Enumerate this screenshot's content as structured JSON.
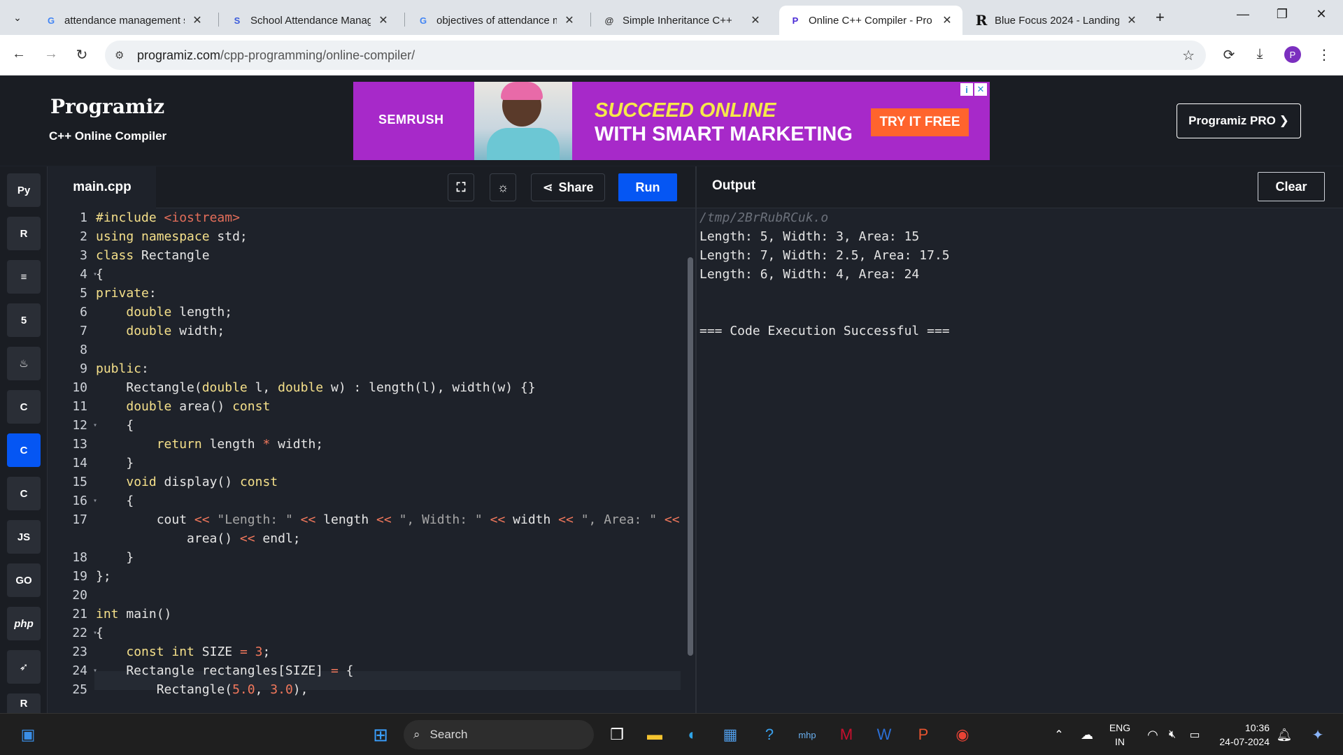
{
  "browser": {
    "tabs": [
      {
        "title": "attendance management s",
        "favicon": "G"
      },
      {
        "title": "School Attendance Manag",
        "favicon": "S"
      },
      {
        "title": "objectives of attendance m",
        "favicon": "G"
      },
      {
        "title": "Simple Inheritance C++",
        "favicon": "@"
      },
      {
        "title": "Online C++ Compiler - Pro",
        "favicon": "P"
      },
      {
        "title": "Blue Focus 2024 - Landing",
        "favicon": "R"
      }
    ],
    "url_domain": "programiz.com",
    "url_path": "/cpp-programming/online-compiler/",
    "profile_initial": "P"
  },
  "site": {
    "logo": "Programiz",
    "subtitle": "C++ Online Compiler",
    "pro_button": "Programiz PRO ❯"
  },
  "ad": {
    "brand": "SEMRUSH",
    "headline_1": "SUCCEED ONLINE",
    "headline_2": "WITH SMART MARKETING",
    "cta": "TRY IT FREE"
  },
  "languages": [
    {
      "name": "python",
      "glyph": "Py"
    },
    {
      "name": "r",
      "glyph": "R"
    },
    {
      "name": "sql",
      "glyph": "≡"
    },
    {
      "name": "html",
      "glyph": "5"
    },
    {
      "name": "java",
      "glyph": "♨"
    },
    {
      "name": "c",
      "glyph": "C"
    },
    {
      "name": "cpp",
      "glyph": "C"
    },
    {
      "name": "csharp",
      "glyph": "C"
    },
    {
      "name": "javascript",
      "glyph": "JS"
    },
    {
      "name": "go",
      "glyph": "GO"
    },
    {
      "name": "php",
      "glyph": "php"
    },
    {
      "name": "swift",
      "glyph": "➶"
    },
    {
      "name": "rust",
      "glyph": "R"
    }
  ],
  "editor": {
    "filename": "main.cpp",
    "share_label": "Share",
    "run_label": "Run"
  },
  "output": {
    "title": "Output",
    "clear_label": "Clear",
    "path": "/tmp/2BrRubRCuk.o",
    "lines": [
      "Length: 5, Width: 3, Area: 15",
      "Length: 7, Width: 2.5, Area: 17.5",
      "Length: 6, Width: 4, Area: 24",
      "",
      "",
      "=== Code Execution Successful ==="
    ]
  },
  "taskbar": {
    "search_placeholder": "Search",
    "lang_line1": "ENG",
    "lang_line2": "IN",
    "time": "10:36",
    "date": "24-07-2024"
  }
}
